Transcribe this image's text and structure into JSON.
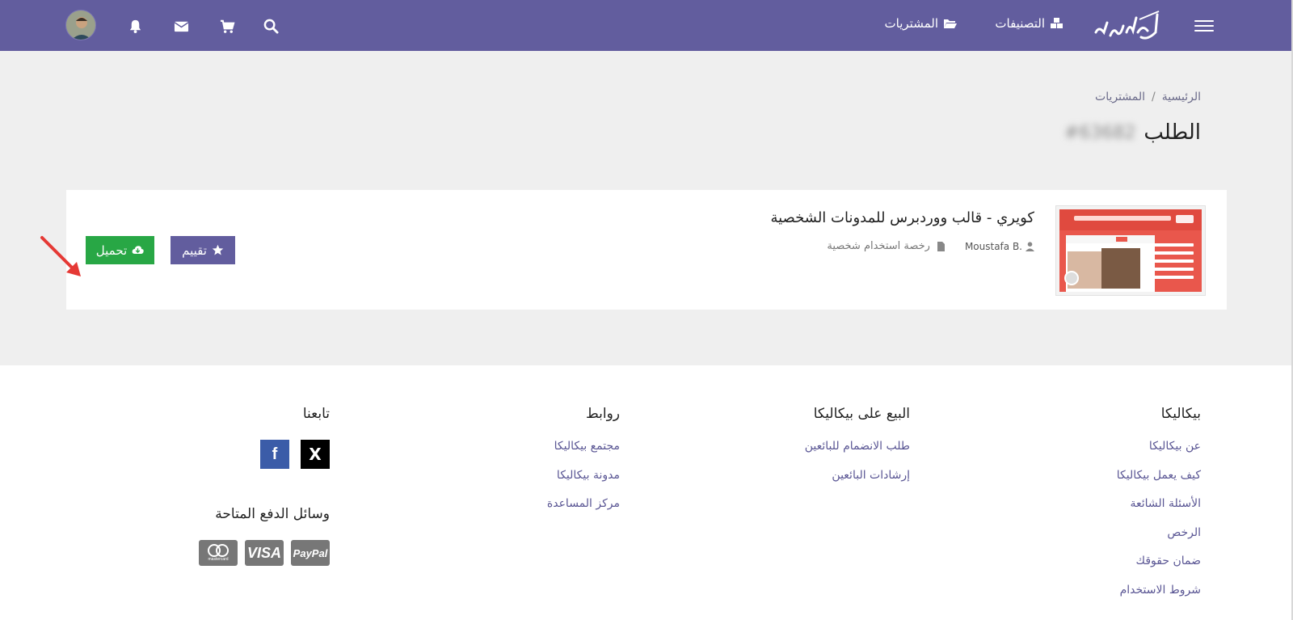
{
  "header": {
    "menu_icon": "hamburger-icon",
    "logo_text": "بيكاليكا",
    "nav": {
      "categories": "التصنيفات",
      "purchases": "المشتريات"
    },
    "icons": [
      "search-icon",
      "cart-icon",
      "envelope-icon",
      "bell-icon"
    ],
    "colors": {
      "bar": "#625d9e"
    }
  },
  "breadcrumb": {
    "home": "الرئيسية",
    "separator": "/",
    "current": "المشتريات"
  },
  "page": {
    "title": "الطلب",
    "order_number": "#63682"
  },
  "order_item": {
    "title": "كويري - قالب ووردبرس للمدونات الشخصية",
    "author": "Moustafa B.",
    "license": "رخصة استخدام شخصية",
    "rate_button": "تقييم",
    "download_button": "تحميل",
    "colors": {
      "rate": "#625d9e",
      "download": "#28a745"
    }
  },
  "footer": {
    "col1": {
      "heading": "بيكاليكا",
      "links": [
        "عن بيكاليكا",
        "كيف يعمل بيكاليكا",
        "الأسئلة الشائعة",
        "الرخص",
        "ضمان حقوقك",
        "شروط الاستخدام"
      ]
    },
    "col2": {
      "heading": "البيع على بيكاليكا",
      "links": [
        "طلب الانضمام للبائعين",
        "إرشادات البائعين"
      ]
    },
    "col3": {
      "heading": "روابط",
      "links": [
        "مجتمع بيكاليكا",
        "مدونة بيكاليكا",
        "مركز المساعدة"
      ]
    },
    "col4": {
      "heading": "تابعنا",
      "social": {
        "x": "X",
        "facebook": "f"
      },
      "payments_heading": "وسائل الدفع المتاحة",
      "payments": {
        "paypal": "PayPal",
        "visa": "VISA",
        "mastercard": "mastercard"
      }
    }
  }
}
